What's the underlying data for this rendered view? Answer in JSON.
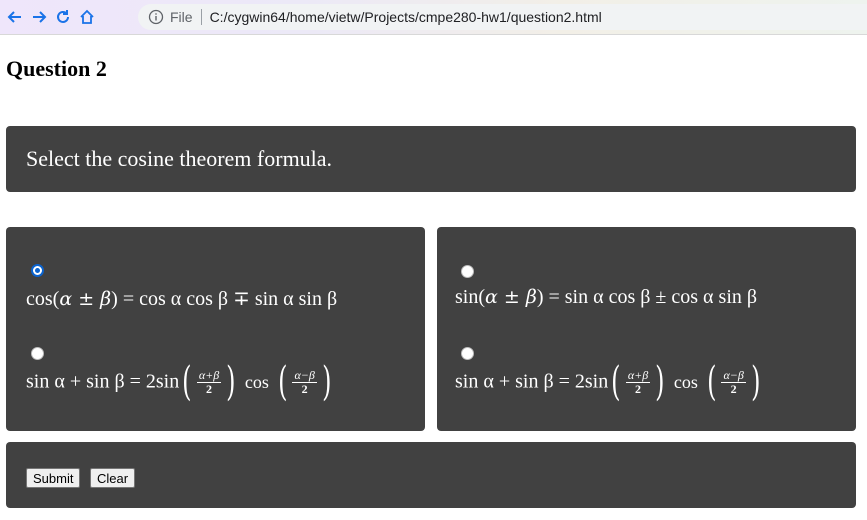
{
  "browser": {
    "file_label": "File",
    "url": "C:/cygwin64/home/vietw/Projects/cmpe280-hw1/question2.html"
  },
  "page": {
    "title": "Question 2",
    "question": "Select the cosine theorem formula."
  },
  "options": [
    {
      "id": "opt1",
      "selected": true,
      "parts": [
        "cos(",
        "α ± β",
        ") = cos α cos β ∓ sin α sin β"
      ]
    },
    {
      "id": "opt2",
      "selected": false,
      "parts": [
        "sin(",
        "α ± β",
        ") = sin α cos β ± cos α sin β"
      ]
    },
    {
      "id": "opt3",
      "selected": false,
      "lead": "sin α + sin β = 2sin",
      "frac1_num": "α+β",
      "frac1_den": "2",
      "mid": "cos",
      "frac2_num": "α−β",
      "frac2_den": "2"
    },
    {
      "id": "opt4",
      "selected": false,
      "lead": "sin α + sin β = 2sin",
      "frac1_num": "α+β",
      "frac1_den": "2",
      "mid": "cos",
      "frac2_num": "α−β",
      "frac2_den": "2"
    }
  ],
  "buttons": {
    "submit": "Submit",
    "clear": "Clear"
  },
  "colors": {
    "panel": "#414141",
    "radio_selected": "#0b63ce"
  }
}
